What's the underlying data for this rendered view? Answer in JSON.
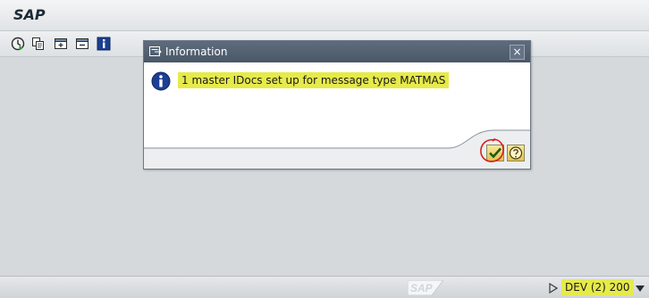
{
  "app": {
    "title": "SAP"
  },
  "toolbar": {
    "buttons": [
      {
        "icon": "execute-icon"
      },
      {
        "icon": "copy-icon"
      },
      {
        "icon": "create-icon"
      },
      {
        "icon": "delete-icon"
      },
      {
        "icon": "info-icon"
      }
    ]
  },
  "dialog": {
    "title": "Information",
    "close_label": "×",
    "message": "1 master IDocs set up for message type MATMAS"
  },
  "status_bar": {
    "system": "DEV (2) 200"
  },
  "colors": {
    "highlight": "#e6ea4a",
    "dialog_header": "#4f5d6e",
    "annotation": "#d42020"
  }
}
